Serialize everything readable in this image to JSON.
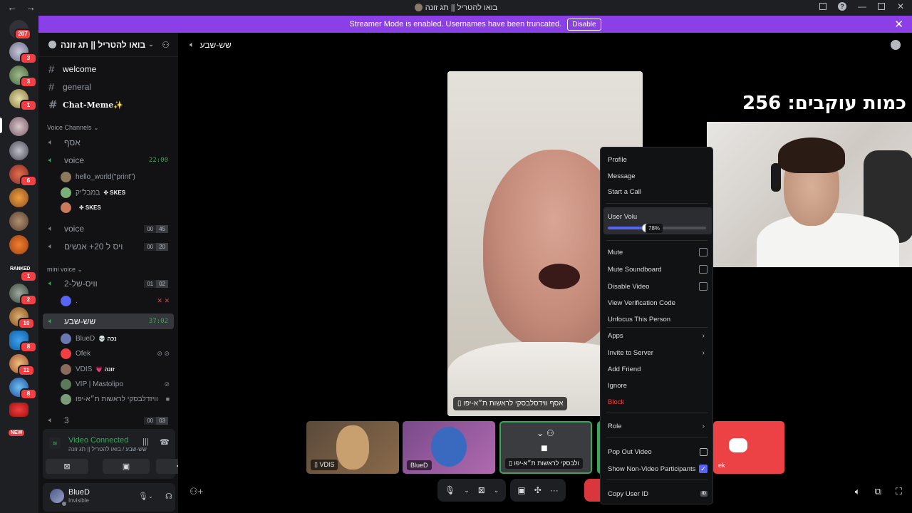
{
  "window": {
    "title": "בואו להטריל || תג זונה"
  },
  "banner": {
    "text": "Streamer Mode is enabled. Usernames have been truncated.",
    "button": "Disable"
  },
  "rail": {
    "home_badge": "207",
    "badges": [
      "3",
      "3",
      "1",
      "6",
      "1",
      "2",
      "10",
      "8",
      "11",
      "8"
    ],
    "ranked_label": "RANKED",
    "new_label": "NEW"
  },
  "server": {
    "name": "בואו להטריל || תג זונה"
  },
  "channels": {
    "text": [
      {
        "name": "welcome",
        "unread": true
      },
      {
        "name": "general",
        "unread": false
      },
      {
        "name": "Chat-Meme✨",
        "unread": true
      }
    ],
    "voice_category": "Voice Channels",
    "voice": [
      {
        "name": "אסף"
      },
      {
        "name": "voice",
        "time": "22:00"
      },
      {
        "name": "voice",
        "count": "00",
        "limit": "45"
      },
      {
        "name": "ויס ל 20+ אנשים",
        "count": "00",
        "limit": "20"
      }
    ],
    "voice_members": [
      {
        "name": "hello_world(\"print\")",
        "tag": ""
      },
      {
        "name": "במבל'יק",
        "tag": "✤ SKES"
      },
      {
        "name": "",
        "tag": "✤ SKES"
      }
    ],
    "mini_category": "mini voice",
    "mini": [
      {
        "name": "וויס-של-2",
        "count": "01",
        "limit": "02"
      },
      {
        "member": "."
      },
      {
        "name": "שש-שבע",
        "time": "37:02"
      }
    ],
    "active_members": [
      {
        "name": "BlueD",
        "tag": "💀 נכה"
      },
      {
        "name": "Ofek",
        "tag": ""
      },
      {
        "name": "VDIS",
        "tag": "💗 זונה"
      },
      {
        "name": "VIP | Mastolipo",
        "tag": ""
      },
      {
        "name": "וויזדלבסקי לראשות ת״א-יפו",
        "tag": ""
      }
    ],
    "last": {
      "name": "3",
      "count": "00",
      "limit": "03"
    }
  },
  "voice_panel": {
    "status": "Video Connected",
    "location": "שש-שבע / בואו להטריל || תג זונה"
  },
  "user": {
    "name": "BlueD",
    "status": "Invisible"
  },
  "main": {
    "channel": "שש-שבע",
    "big_video_label": "אסף ווידסלבסקי לראשות ת״א-יפו",
    "overlay_text": "כמות עוקבים: 256",
    "tiles": [
      {
        "label": "VDIS"
      },
      {
        "label": "BlueD"
      },
      {
        "label": "ולבסקי לראשות ת״א-יפו"
      },
      {
        "label": "ek"
      }
    ]
  },
  "context_menu": {
    "items": {
      "profile": "Profile",
      "message": "Message",
      "start_call": "Start a Call",
      "user_volume": "User Volu",
      "volume_value": "78%",
      "volume_fraction": 0.39,
      "mute": "Mute",
      "mute_soundboard": "Mute Soundboard",
      "disable_video": "Disable Video",
      "view_verification": "View Verification Code",
      "unfocus": "Unfocus This Person",
      "apps": "Apps",
      "invite": "Invite to Server",
      "add_friend": "Add Friend",
      "ignore": "Ignore",
      "block": "Block",
      "role": "Role",
      "pop_out": "Pop Out Video",
      "show_non_video": "Show Non-Video Participants",
      "copy_id": "Copy User ID",
      "id_badge": "ID"
    }
  },
  "colors": {
    "accent": "#5865f2",
    "banner": "#8a40e6",
    "danger": "#f23f43",
    "online": "#3ba55c"
  }
}
